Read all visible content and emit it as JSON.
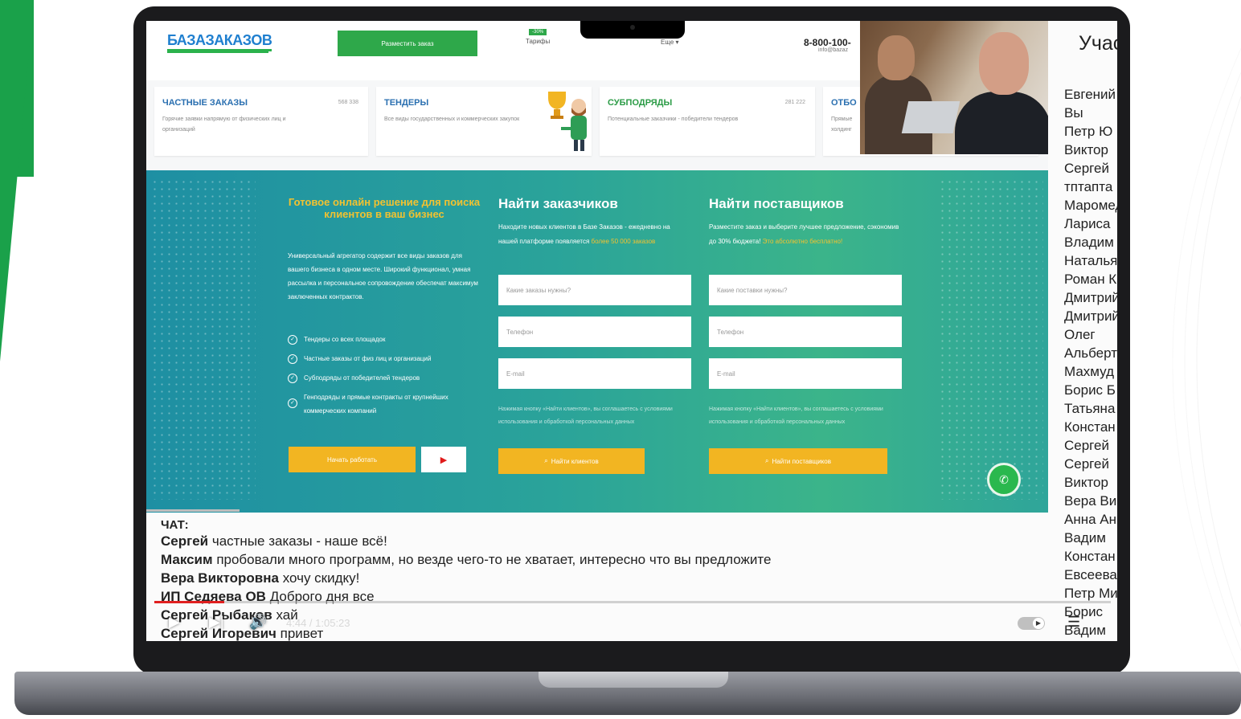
{
  "site": {
    "logo": "БАЗАЗАКАЗОВ",
    "place_order": "Разместить заказ",
    "tariffs_badge": "-30%",
    "tariffs": "Тарифы",
    "more": "Еще ▾",
    "phone": "8-800-100-",
    "email": "info@bazaz",
    "cards": [
      {
        "title": "ЧАСТНЫЕ ЗАКАЗЫ",
        "count": "568 338",
        "desc": "Горячие заявки напрямую от физических лиц и организаций"
      },
      {
        "title": "ТЕНДЕРЫ",
        "count": "",
        "desc": "Все виды государственных и коммерческих закупок"
      },
      {
        "title": "СУБПОДРЯДЫ",
        "count": "281 222",
        "desc": "Потенциальные заказчики - победители тендеров"
      },
      {
        "title": "ОТБО",
        "count": "",
        "desc": "Прямые холдинг"
      }
    ],
    "hero": {
      "tagline": "Готовое онлайн решение для поиска клиентов в ваш бизнес",
      "description": "Универсальный агрегатор содержит все виды заказов для вашего бизнеса в одном месте. Широкий функционал, умная рассылка и персональное сопровождение обеспечат максимум заключенных контрактов.",
      "features": [
        "Тендеры со всех площадок",
        "Частные заказы от физ лиц и организаций",
        "Субподряды от победителей тендеров",
        "Генподряды и прямые контракты от крупнейших коммерческих компаний"
      ],
      "start_btn": "Начать работать",
      "play_icon": "▶"
    },
    "find_clients": {
      "title": "Найти заказчиков",
      "desc": "Находите новых клиентов в Базе Заказов - ежедневно на нашей платформе появляется",
      "highlight": "более 50 000 заказов",
      "field1_placeholder": "Какие заказы нужны?",
      "field2_placeholder": "Телефон",
      "field3_placeholder": "E-mail",
      "consent": "Нажимая кнопку «Найти клиентов», вы соглашаетесь с условиями использования и обработкой персональных данных",
      "button": "Найти клиентов"
    },
    "find_suppliers": {
      "title": "Найти поставщиков",
      "desc": "Разместите заказ и выберите лучшее предложение, сэкономив до 30% бюджета!",
      "highlight": "Это абсолютно бесплатно!",
      "field1_placeholder": "Какие поставки нужны?",
      "field2_placeholder": "Телефон",
      "field3_placeholder": "E-mail",
      "consent": "Нажимая кнопку «Найти клиентов», вы соглашаетесь с условиями использования и обработкой персональных данных",
      "button": "Найти поставщиков"
    },
    "call_icon": "✆"
  },
  "participants": {
    "title": "Участники",
    "names": [
      "Евгений",
      "Вы",
      "Петр Ю",
      "Виктор",
      "Сергей",
      "тптапта",
      "Маромед",
      "Лариса",
      "Владим",
      "Наталья",
      "Роман К",
      "Дмитрий",
      "Дмитрий",
      "Олег",
      "Альберт",
      "Махмуд",
      "Борис Б",
      "Татьяна",
      "Констан",
      "Сергей",
      "Сергей",
      "Виктор",
      "Вера Ви",
      "Анна Ан",
      "Вадим",
      "Констан",
      "Евсеева",
      "Петр Ми",
      "Борис",
      "Вадим"
    ]
  },
  "chat": {
    "label": "ЧАТ:",
    "messages": [
      {
        "author": "Сергей",
        "text": " частные заказы - наше всё!"
      },
      {
        "author": "Максим",
        "text": " пробовали много программ, но везде чего-то не хватает, интересно что вы предложите"
      },
      {
        "author": "Вера Викторовна",
        "text": " хочу скидку!"
      },
      {
        "author": "ИП Седяева ОВ",
        "text": " Доброго дня все"
      },
      {
        "author": "Сергей Рыбаков",
        "text": " хай"
      },
      {
        "author": "Сергей Игоревич",
        "text": " привет"
      }
    ]
  },
  "player": {
    "time": "4:44 / 1:05:23",
    "progress": 0.073,
    "play_icon": "▶",
    "next_icon": "▶|",
    "volume_icon": "🔊",
    "menu_icon": "☰"
  }
}
